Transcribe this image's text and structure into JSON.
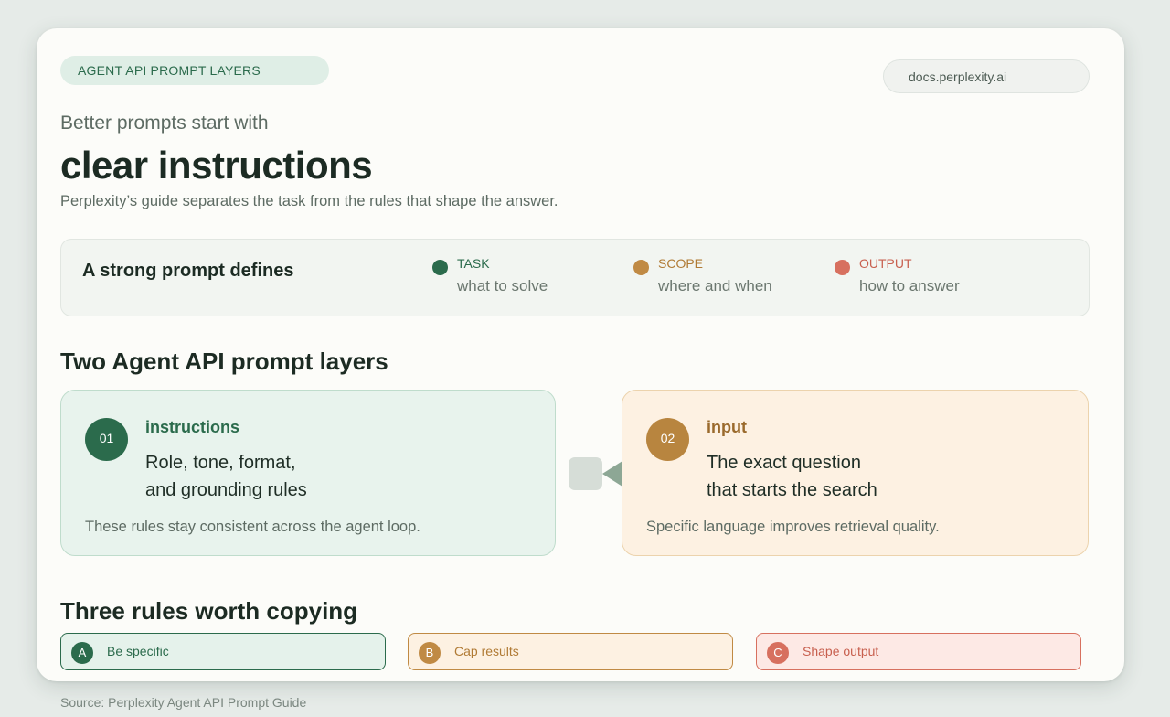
{
  "header": {
    "kicker": "AGENT API PROMPT LAYERS",
    "url": "docs.perplexity.ai",
    "eyebrow": "Better prompts start with",
    "headline": "clear instructions",
    "subhead": "Perplexity’s guide separates the task from the rules that shape the answer."
  },
  "defines": {
    "title": "A strong prompt defines",
    "items": [
      {
        "label": "TASK",
        "desc": "what to solve",
        "color": "#2b6b4c"
      },
      {
        "label": "SCOPE",
        "desc": "where and when",
        "color": "#c08a44"
      },
      {
        "label": "OUTPUT",
        "desc": "how to answer",
        "color": "#d7705f"
      }
    ]
  },
  "layers": {
    "title": "Two Agent API prompt layers",
    "items": [
      {
        "num": "01",
        "key": "instructions",
        "desc": "Role, tone, format,\nand grounding rules",
        "note": "These rules stay consistent across the agent loop.",
        "color": "#2b6b4c"
      },
      {
        "num": "02",
        "key": "input",
        "desc": "The exact question\nthat starts the search",
        "note": "Specific language improves retrieval quality.",
        "color": "#b8853f"
      }
    ]
  },
  "rules": {
    "title": "Three rules worth copying",
    "items": [
      {
        "badge": "A",
        "label": "Be specific",
        "color": "#2b6b4c"
      },
      {
        "badge": "B",
        "label": "Cap results",
        "color": "#c08a44"
      },
      {
        "badge": "C",
        "label": "Shape output",
        "color": "#d7705f"
      }
    ]
  },
  "footer": {
    "source": "Source: Perplexity Agent API Prompt Guide"
  }
}
